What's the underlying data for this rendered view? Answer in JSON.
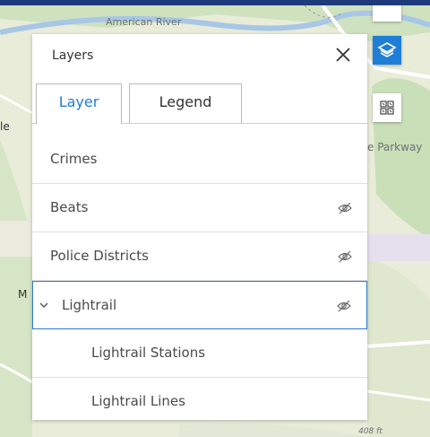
{
  "map": {
    "labels": {
      "river": "American River",
      "west": "le",
      "parkway": "e Parkway",
      "west_m": "M",
      "elevation": "408 ft"
    }
  },
  "layers_panel": {
    "title": "Layers",
    "close_icon": "close-icon",
    "tabs": {
      "layer": "Layer",
      "legend": "Legend"
    },
    "items": [
      {
        "label": "Crimes",
        "visible": true
      },
      {
        "label": "Beats",
        "visible": false
      },
      {
        "label": "Police Districts",
        "visible": false
      },
      {
        "label": "Lightrail",
        "visible": false,
        "expanded": true
      },
      {
        "label": "Lightrail Stations"
      },
      {
        "label": "Lightrail Lines"
      }
    ]
  },
  "toolbar": {
    "layers_button_icon": "layers-icon",
    "qr_button_icon": "grid-icon"
  },
  "colors": {
    "accent": "#2b79c9",
    "active_button": "#1f7ed6",
    "top_bar": "#1f3a7a"
  }
}
